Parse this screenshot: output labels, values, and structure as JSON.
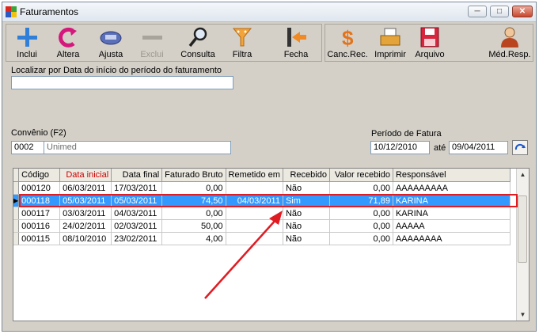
{
  "window": {
    "title": "Faturamentos",
    "controls": [
      "─",
      "□",
      "✕"
    ]
  },
  "toolbar": {
    "buttons": [
      {
        "label": "Inclui",
        "icon": "plus-icon"
      },
      {
        "label": "Altera",
        "icon": "refresh-icon"
      },
      {
        "label": "Ajusta",
        "icon": "keyboard-icon"
      },
      {
        "label": "Exclui",
        "icon": "minus-icon"
      },
      {
        "label": "Consulta",
        "icon": "magnifier-icon"
      },
      {
        "label": "Filtra",
        "icon": "funnel-icon"
      },
      {
        "label": "Fecha",
        "icon": "exit-door-icon"
      }
    ],
    "buttons2": [
      {
        "label": "Canc.Rec.",
        "icon": "dollar-icon"
      },
      {
        "label": "Imprimir",
        "icon": "printer-icon"
      },
      {
        "label": "Arquivo",
        "icon": "floppy-disk-icon"
      },
      {
        "label": "Méd.Resp.",
        "icon": "doctor-icon"
      }
    ]
  },
  "search": {
    "label": "Localizar por Data do início do período do faturamento",
    "value": ""
  },
  "convenio": {
    "label": "Convênio (F2)",
    "code": "0002",
    "name": "Unimed"
  },
  "periodo": {
    "label": "Período de Fatura",
    "from": "10/12/2010",
    "sep": "até",
    "to": "09/04/2011"
  },
  "table": {
    "headers": [
      "Código",
      "Data inicial",
      "Data final",
      "Faturado Bruto",
      "Remetido em",
      "Recebido",
      "Valor recebido",
      "Responsável"
    ],
    "rows": [
      [
        "000120",
        "06/03/2011",
        "17/03/2011",
        "0,00",
        "",
        "Não",
        "0,00",
        "AAAAAAAAA"
      ],
      [
        "000118",
        "05/03/2011",
        "05/03/2011",
        "74,50",
        "04/03/2011",
        "Sim",
        "71,89",
        "KARINA"
      ],
      [
        "000117",
        "03/03/2011",
        "04/03/2011",
        "0,00",
        "",
        "Não",
        "0,00",
        "KARINA"
      ],
      [
        "000116",
        "24/02/2011",
        "02/03/2011",
        "50,00",
        "",
        "Não",
        "0,00",
        "AAAAA"
      ],
      [
        "000115",
        "08/10/2010",
        "23/02/2011",
        "4,00",
        "",
        "Não",
        "0,00",
        "AAAAAAAA"
      ]
    ],
    "selected_index": 1
  },
  "colors": {
    "accent_red": "#e11b22",
    "selection": "#3399ff",
    "sorted_header": "#cc0000"
  }
}
